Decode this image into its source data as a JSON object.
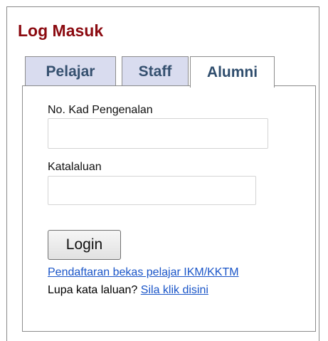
{
  "panel": {
    "title": "Log Masuk"
  },
  "tabs": [
    {
      "label": "Pelajar",
      "active": false
    },
    {
      "label": "Staff",
      "active": false
    },
    {
      "label": "Alumni",
      "active": true
    }
  ],
  "form": {
    "ic_label": "No. Kad Pengenalan",
    "ic_value": "",
    "ic_placeholder": "",
    "password_label": "Katalaluan",
    "password_value": "",
    "password_placeholder": "",
    "login_label": "Login",
    "register_link": "Pendaftaran bekas pelajar IKM/KKTM",
    "forgot_text": "Lupa kata laluan?",
    "forgot_link": "Sila klik disini"
  },
  "colors": {
    "title": "#8b0a10",
    "tab_inactive_bg": "#d9dcef",
    "tab_text": "#35506f",
    "link": "#1a55c8"
  }
}
